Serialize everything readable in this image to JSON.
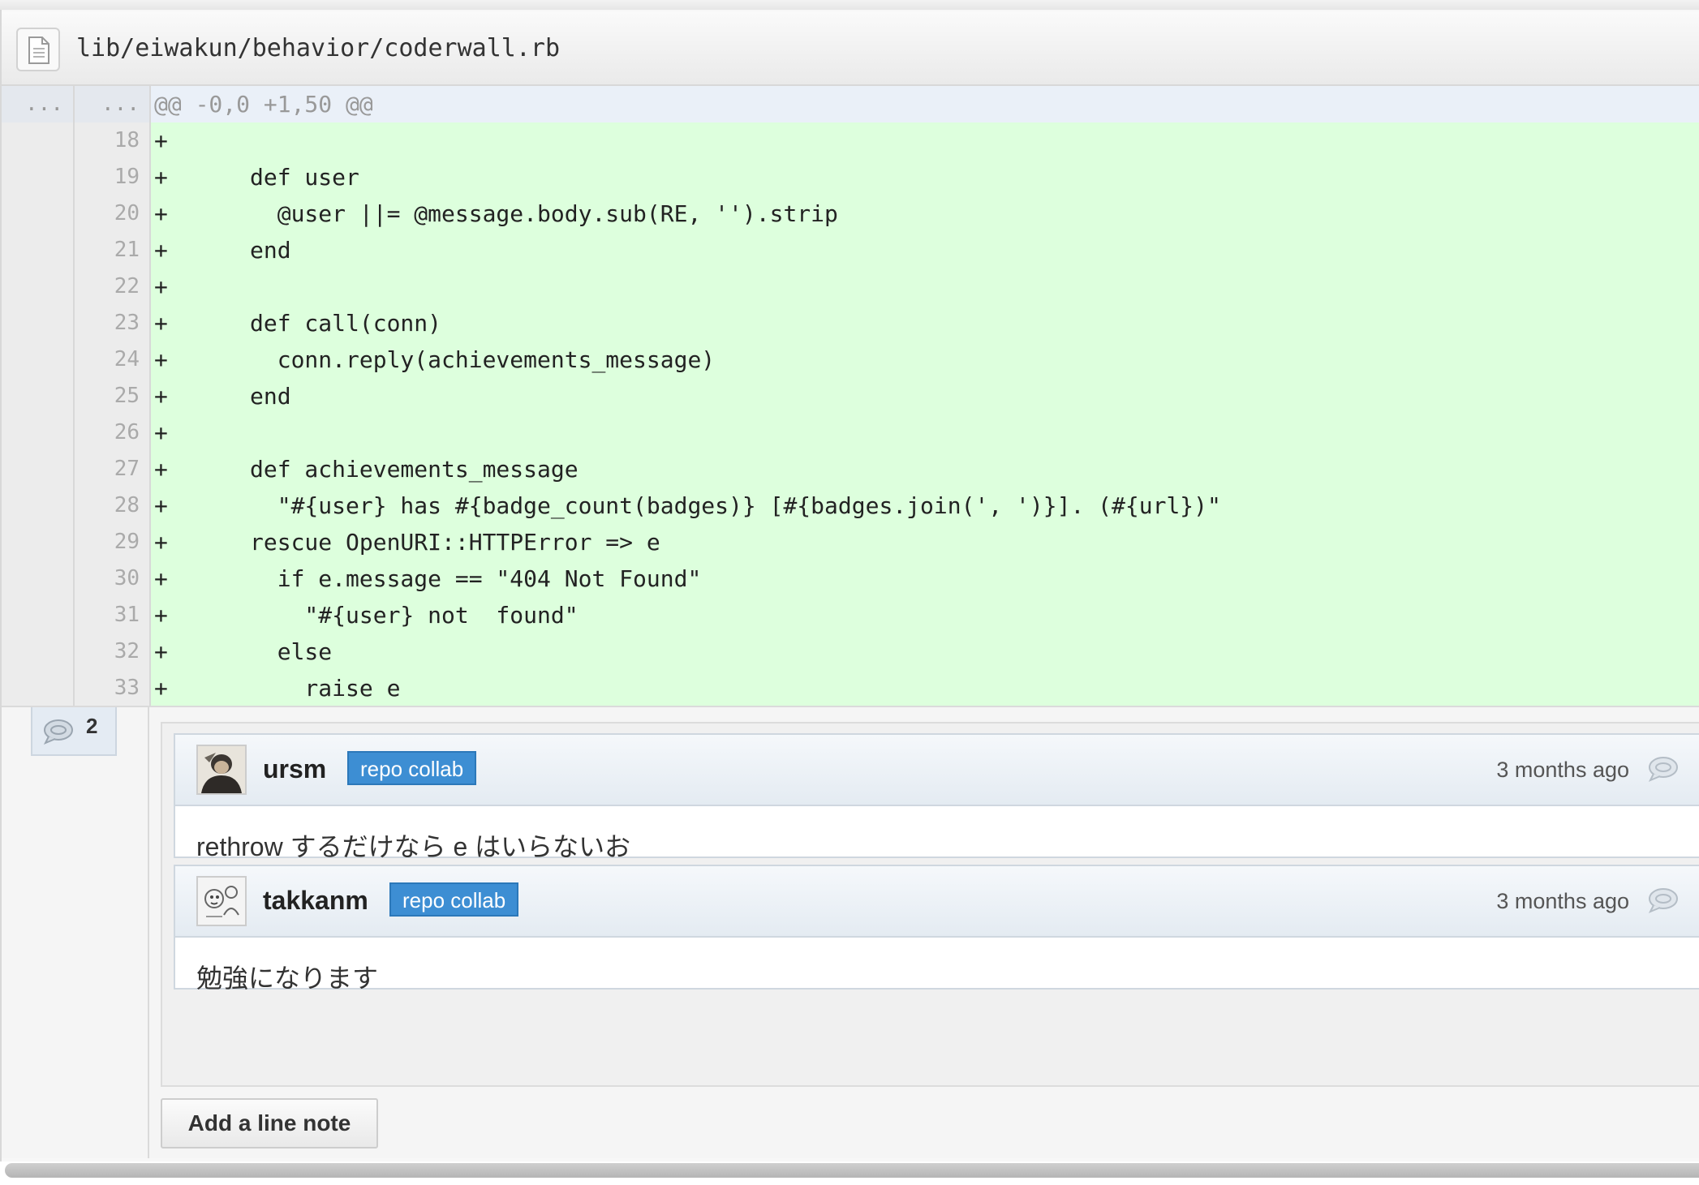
{
  "file": {
    "path": "lib/eiwakun/behavior/coderwall.rb"
  },
  "diff": {
    "hunk": {
      "old": "...",
      "new": "...",
      "text": "@@ -0,0 +1,50 @@"
    },
    "lines": [
      {
        "num": "18",
        "text": "+"
      },
      {
        "num": "19",
        "text": "+      def user"
      },
      {
        "num": "20",
        "text": "+        @user ||= @message.body.sub(RE, '').strip"
      },
      {
        "num": "21",
        "text": "+      end"
      },
      {
        "num": "22",
        "text": "+"
      },
      {
        "num": "23",
        "text": "+      def call(conn)"
      },
      {
        "num": "24",
        "text": "+        conn.reply(achievements_message)"
      },
      {
        "num": "25",
        "text": "+      end"
      },
      {
        "num": "26",
        "text": "+"
      },
      {
        "num": "27",
        "text": "+      def achievements_message"
      },
      {
        "num": "28",
        "text": "+        \"#{user} has #{badge_count(badges)} [#{badges.join(', ')}]. (#{url})\""
      },
      {
        "num": "29",
        "text": "+      rescue OpenURI::HTTPError => e"
      },
      {
        "num": "30",
        "text": "+        if e.message == \"404 Not Found\""
      },
      {
        "num": "31",
        "text": "+          \"#{user} not  found\""
      },
      {
        "num": "32",
        "text": "+        else"
      },
      {
        "num": "33",
        "text": "+          raise e"
      }
    ]
  },
  "comments": {
    "count": "2",
    "items": [
      {
        "author": "ursm",
        "badge": "repo collab",
        "time": "3 months ago",
        "body": "rethrow するだけなら e はいらないお"
      },
      {
        "author": "takkanm",
        "badge": "repo collab",
        "time": "3 months ago",
        "body": "勉強になります"
      }
    ],
    "add_note_label": "Add a line note"
  },
  "icons": {
    "file": "file-icon",
    "comment_count": "speech-bubble-icon",
    "reply": "reply-bubble-icon"
  },
  "colors": {
    "added_line_bg": "#ddffdd",
    "hunk_bg": "#eaf0f8",
    "badge_bg": "#3d8ed3"
  }
}
